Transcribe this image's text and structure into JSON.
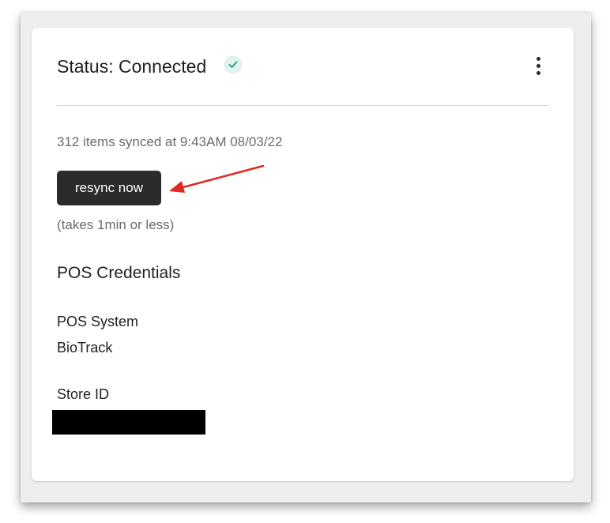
{
  "status": {
    "title": "Status: Connected",
    "badge_icon": "check-circle-icon",
    "badge_color": "#1c9a7a",
    "menu_icon": "kebab-menu-icon"
  },
  "sync": {
    "info": "312 items synced at 9:43AM 08/03/22",
    "button_label": "resync now",
    "note": "(takes 1min or less)",
    "annotation_icon": "red-arrow-icon",
    "annotation_color": "#e02a20"
  },
  "credentials": {
    "title": "POS Credentials",
    "pos_system_label": "POS System",
    "pos_system_value": "BioTrack",
    "store_id_label": "Store ID"
  }
}
